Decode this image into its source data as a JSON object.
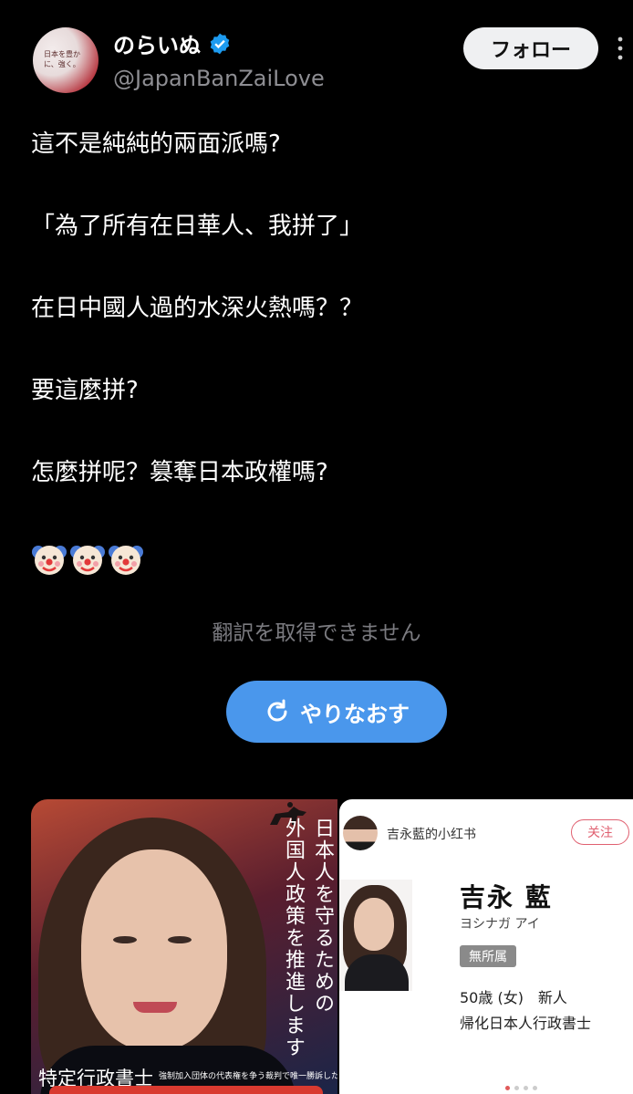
{
  "header": {
    "avatar_text": "日本を豊かに、強く。",
    "display_name": "のらいぬ",
    "handle": "@JapanBanZaiLove",
    "follow_label": "フォロー"
  },
  "tweet": {
    "lines": [
      "這不是純純的兩面派嗎?",
      "「為了所有在日華人、我拼了」",
      "在日中國人過的水深火熱嗎？？",
      "要這麼拼?",
      "怎麼拼呢？篡奪日本政權嗎?"
    ],
    "emoji": [
      "🤡",
      "🤡",
      "🤡"
    ]
  },
  "translation": {
    "error_text": "翻訳を取得できません",
    "retry_label": "やりなおす"
  },
  "media": {
    "poster": {
      "vertical_col1": "日本人を守るための",
      "vertical_col2": "外国人政策を推進します",
      "subtitle": "特定行政書士",
      "tiny_text": "強制加入団体の代表権を争う裁判で唯一勝訴した原告"
    },
    "profile_card": {
      "title": "吉永藍的小红书",
      "follow_label": "关注",
      "name": "吉永 藍",
      "kana": "ヨシナガ アイ",
      "badge": "無所属",
      "age": "50歳 (女)　新人",
      "occupation": "帰化日本人行政書士"
    }
  },
  "colors": {
    "background": "#000000",
    "verified": "#1d9bf0",
    "retry_button": "#4a97ec",
    "muted_text": "#7b7b80"
  }
}
